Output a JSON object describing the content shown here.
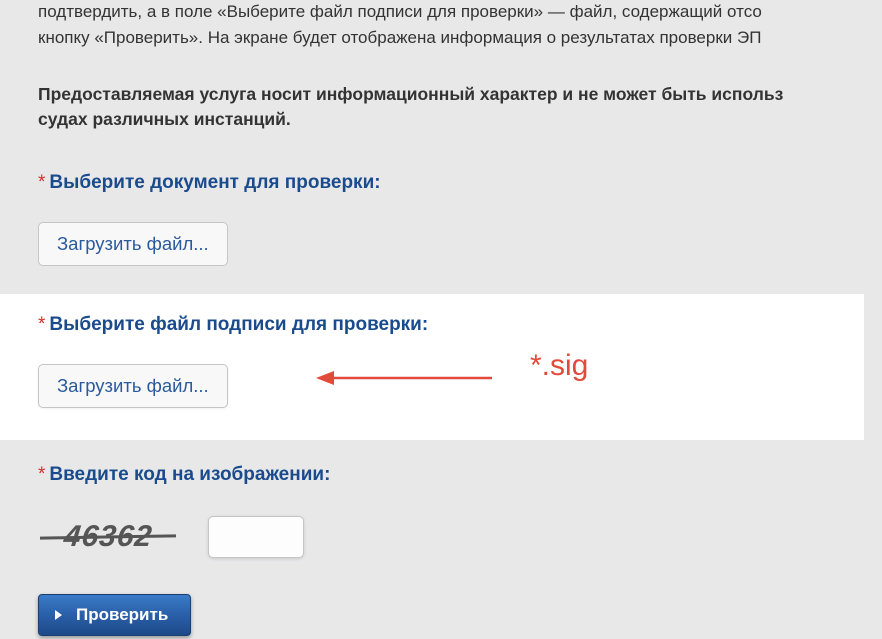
{
  "intro": {
    "line1": "подтвердить, а в поле «Выберите файл подписи для проверки» — файл, содержащий отсо",
    "line2": "кнопку «Проверить». На экране будет отображена информация о результатах проверки ЭП"
  },
  "disclaimer": {
    "line1": "Предоставляемая услуга носит информационный характер и не может быть использ",
    "line2": "судах различных инстанций."
  },
  "fields": {
    "doc_label": "Выберите документ для проверки:",
    "sig_label": "Выберите файл подписи для проверки:",
    "captcha_label": "Введите код на изображении:"
  },
  "buttons": {
    "upload": "Загрузить файл...",
    "submit": "Проверить"
  },
  "annotation": {
    "sig_hint": "*.sig"
  },
  "captcha": {
    "code": "46362"
  },
  "required_mark": "*"
}
